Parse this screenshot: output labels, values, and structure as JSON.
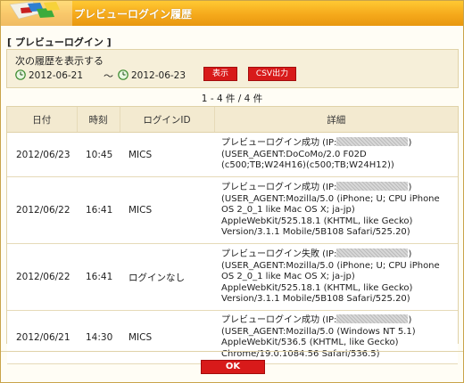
{
  "window": {
    "title": "プレビューログイン履歴"
  },
  "section": {
    "heading": "[ プレビューログイン ]"
  },
  "range": {
    "label": "次の履歴を表示する",
    "from_date": "2012-06-21",
    "separator": "～",
    "to_date": "2012-06-23",
    "show_button": "表示",
    "csv_button": "CSV出力"
  },
  "count": "1 - 4 件 / 4 件",
  "table": {
    "headers": [
      "日付",
      "時刻",
      "ログインID",
      "詳細"
    ],
    "rows": [
      {
        "date": "2012/06/23",
        "time": "10:45",
        "login_id": "MICS",
        "status": "プレビューログイン成功 (IP:",
        "close": ")",
        "detail": [
          "(USER_AGENT:DoCoMo/2.0 F02D",
          "(c500;TB;W24H16)(c500;TB;W24H12))"
        ]
      },
      {
        "date": "2012/06/22",
        "time": "16:41",
        "login_id": "MICS",
        "status": "プレビューログイン成功 (IP:",
        "close": ")",
        "detail": [
          "(USER_AGENT:Mozilla/5.0 (iPhone; U; CPU iPhone",
          "OS 2_0_1 like Mac OS X; ja-jp)",
          "AppleWebKit/525.18.1 (KHTML, like Gecko)",
          "Version/3.1.1 Mobile/5B108 Safari/525.20)"
        ]
      },
      {
        "date": "2012/06/22",
        "time": "16:41",
        "login_id": "ログインなし",
        "status": "プレビューログイン失敗 (IP:",
        "close": ")",
        "detail": [
          "(USER_AGENT:Mozilla/5.0 (iPhone; U; CPU iPhone",
          "OS 2_0_1 like Mac OS X; ja-jp)",
          "AppleWebKit/525.18.1 (KHTML, like Gecko)",
          "Version/3.1.1 Mobile/5B108 Safari/525.20)"
        ]
      },
      {
        "date": "2012/06/21",
        "time": "14:30",
        "login_id": "MICS",
        "status": "プレビューログイン成功 (IP:",
        "close": ")",
        "detail": [
          "(USER_AGENT:Mozilla/5.0 (Windows NT 5.1)",
          "AppleWebKit/536.5 (KHTML, like Gecko)",
          "Chrome/19.0.1084.56 Safari/536.5)"
        ]
      }
    ]
  },
  "footer": {
    "ok_button": "OK"
  },
  "colors": {
    "title_bar": "#f5a91b",
    "button_red": "#d81a1a",
    "panel_beige": "#f6efd9"
  },
  "icons": [
    "logo-icon",
    "clock-icon"
  ]
}
